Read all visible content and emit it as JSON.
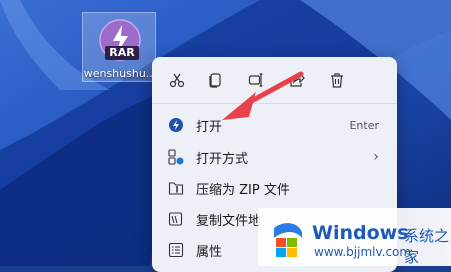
{
  "desktop": {
    "file_name": "wenshushu...",
    "file_badge": "RAR"
  },
  "toolbar": {
    "cut_icon": "scissors-icon",
    "copy_icon": "copy-icon",
    "rename_icon": "rename-icon",
    "share_icon": "share-icon",
    "delete_icon": "trash-icon"
  },
  "menu": {
    "items": [
      {
        "label": "打开",
        "shortcut": "Enter",
        "icon": "open-app-icon"
      },
      {
        "label": "打开方式",
        "icon": "open-with-icon",
        "has_submenu": true
      },
      {
        "label": "压缩为 ZIP 文件",
        "icon": "zip-folder-icon"
      },
      {
        "label": "复制文件地",
        "icon": "copy-path-icon"
      },
      {
        "label": "属性",
        "icon": "properties-icon"
      }
    ]
  },
  "watermark": {
    "brand": "Windows",
    "brand_cn": "系统之家",
    "url": "www.bjjmlv.com"
  },
  "colors": {
    "accent": "#e8414c",
    "wallpaper": "#1b3f8f",
    "menu_bg": "#eef0f7",
    "watermark_text": "#1e5ab8"
  }
}
